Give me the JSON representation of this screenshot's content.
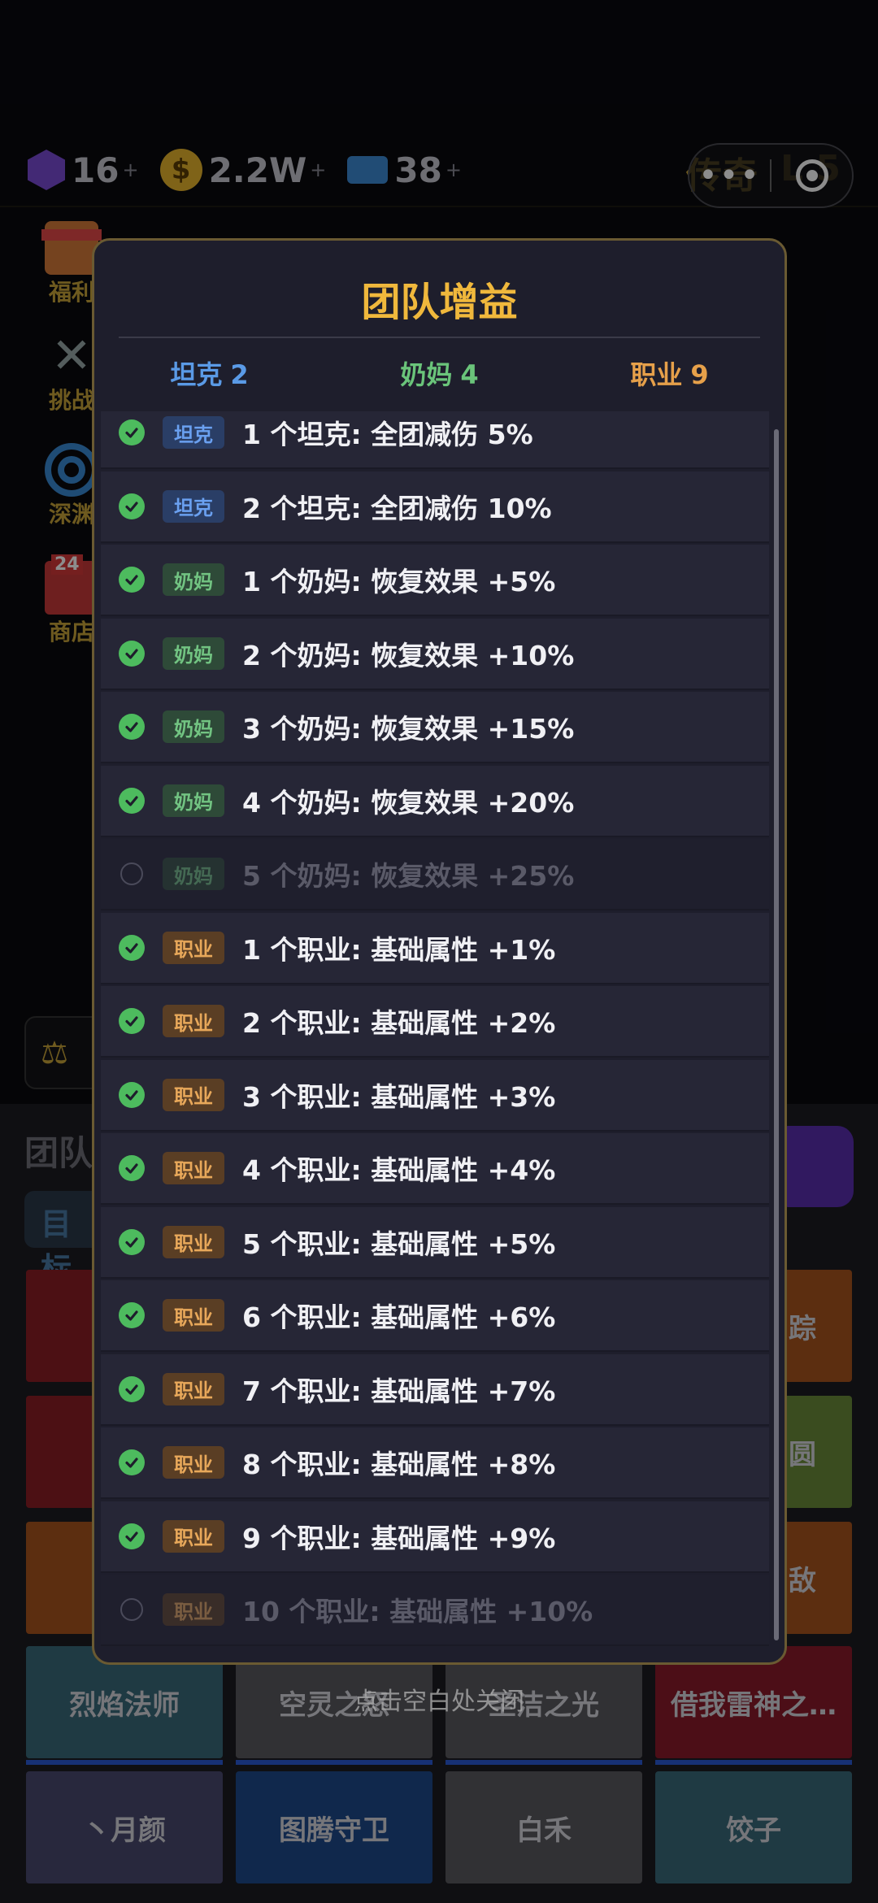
{
  "topbar": {
    "gems": "16",
    "coins": "2.2W",
    "coin_symbol": "$",
    "tickets": "38",
    "plus": "+",
    "legend_title": "传奇",
    "legend_level": "L 5",
    "capsule_dots": "•••"
  },
  "sidebar": {
    "items": [
      {
        "label": "福利",
        "icon": "gift-icon"
      },
      {
        "label": "挑战",
        "icon": "crossed-swords-icon"
      },
      {
        "label": "深渊",
        "icon": "spiral-icon"
      },
      {
        "label": "商店",
        "icon": "shop-icon",
        "badge": "24"
      }
    ]
  },
  "bottom": {
    "title": "团队",
    "tab": "目标",
    "scale_icon": "⚖"
  },
  "grid": {
    "row4": [
      "烈焰法师",
      "空灵之怒",
      "圣洁之光",
      "借我雷神之…"
    ],
    "row5": [
      "丶月颜",
      "图腾守卫",
      "白禾",
      "饺子"
    ],
    "right_col": [
      "踪",
      "圆",
      "敌"
    ]
  },
  "modal": {
    "title": "团队增益",
    "summary": [
      {
        "label": "坦克",
        "count": "2"
      },
      {
        "label": "奶妈",
        "count": "4"
      },
      {
        "label": "职业",
        "count": "9"
      }
    ],
    "rows": [
      {
        "tag": "坦克",
        "text": "1 个坦克: 全团减伤 5%",
        "active": true
      },
      {
        "tag": "坦克",
        "text": "2 个坦克: 全团减伤 10%",
        "active": true
      },
      {
        "tag": "奶妈",
        "text": "1 个奶妈: 恢复效果 +5%",
        "active": true
      },
      {
        "tag": "奶妈",
        "text": "2 个奶妈: 恢复效果 +10%",
        "active": true
      },
      {
        "tag": "奶妈",
        "text": "3 个奶妈: 恢复效果 +15%",
        "active": true
      },
      {
        "tag": "奶妈",
        "text": "4 个奶妈: 恢复效果 +20%",
        "active": true
      },
      {
        "tag": "奶妈",
        "text": "5 个奶妈: 恢复效果 +25%",
        "active": false
      },
      {
        "tag": "职业",
        "text": "1 个职业: 基础属性 +1%",
        "active": true
      },
      {
        "tag": "职业",
        "text": "2 个职业: 基础属性 +2%",
        "active": true
      },
      {
        "tag": "职业",
        "text": "3 个职业: 基础属性 +3%",
        "active": true
      },
      {
        "tag": "职业",
        "text": "4 个职业: 基础属性 +4%",
        "active": true
      },
      {
        "tag": "职业",
        "text": "5 个职业: 基础属性 +5%",
        "active": true
      },
      {
        "tag": "职业",
        "text": "6 个职业: 基础属性 +6%",
        "active": true
      },
      {
        "tag": "职业",
        "text": "7 个职业: 基础属性 +7%",
        "active": true
      },
      {
        "tag": "职业",
        "text": "8 个职业: 基础属性 +8%",
        "active": true
      },
      {
        "tag": "职业",
        "text": "9 个职业: 基础属性 +9%",
        "active": true
      },
      {
        "tag": "职业",
        "text": "10 个职业: 基础属性 +10%",
        "active": false
      }
    ],
    "hint": "点击空白处关闭"
  }
}
